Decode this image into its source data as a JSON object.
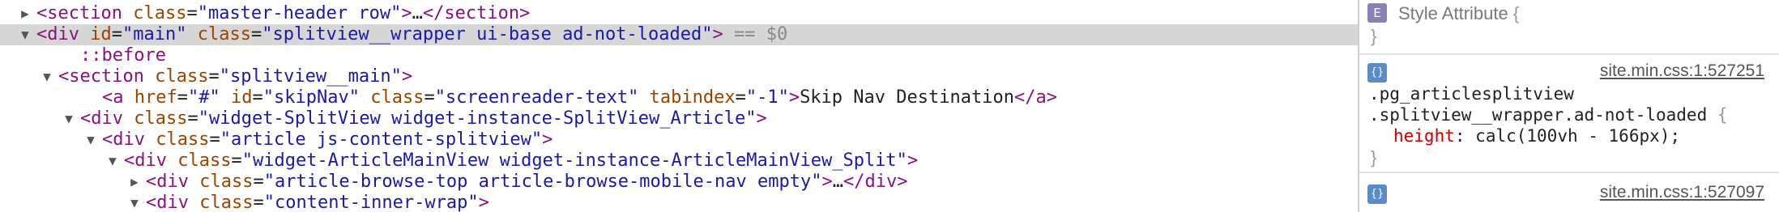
{
  "dom": {
    "lines": [
      {
        "indent": 1,
        "arrow": "▶",
        "parts": [
          {
            "cls": "tag",
            "t": "<section"
          },
          {
            "cls": "txt",
            "t": " "
          },
          {
            "cls": "attr",
            "t": "class"
          },
          {
            "cls": "txt",
            "t": "="
          },
          {
            "cls": "val",
            "t": "\"master-header row\""
          },
          {
            "cls": "tag",
            "t": ">"
          },
          {
            "cls": "ellip",
            "t": "…"
          },
          {
            "cls": "tag",
            "t": "</section>"
          }
        ]
      },
      {
        "indent": 1,
        "arrow": "▼",
        "selected": true,
        "parts": [
          {
            "cls": "tag",
            "t": "<div"
          },
          {
            "cls": "txt",
            "t": " "
          },
          {
            "cls": "attr",
            "t": "id"
          },
          {
            "cls": "txt",
            "t": "="
          },
          {
            "cls": "val",
            "t": "\"main\""
          },
          {
            "cls": "txt",
            "t": " "
          },
          {
            "cls": "attr",
            "t": "class"
          },
          {
            "cls": "txt",
            "t": "="
          },
          {
            "cls": "val",
            "t": "\"splitview__wrapper ui-base ad-not-loaded\""
          },
          {
            "cls": "tag",
            "t": ">"
          },
          {
            "cls": "dim",
            "t": " == $0"
          }
        ]
      },
      {
        "indent": 3,
        "arrow": "",
        "parts": [
          {
            "cls": "pseudo",
            "t": "::before"
          }
        ]
      },
      {
        "indent": 2,
        "arrow": "▼",
        "parts": [
          {
            "cls": "tag",
            "t": "<section"
          },
          {
            "cls": "txt",
            "t": " "
          },
          {
            "cls": "attr",
            "t": "class"
          },
          {
            "cls": "txt",
            "t": "="
          },
          {
            "cls": "val",
            "t": "\"splitview__main\""
          },
          {
            "cls": "tag",
            "t": ">"
          }
        ]
      },
      {
        "indent": 4,
        "arrow": "",
        "parts": [
          {
            "cls": "tag",
            "t": "<a"
          },
          {
            "cls": "txt",
            "t": " "
          },
          {
            "cls": "attr",
            "t": "href"
          },
          {
            "cls": "txt",
            "t": "="
          },
          {
            "cls": "link",
            "t": "\"#\""
          },
          {
            "cls": "txt",
            "t": " "
          },
          {
            "cls": "attr",
            "t": "id"
          },
          {
            "cls": "txt",
            "t": "="
          },
          {
            "cls": "val",
            "t": "\"skipNav\""
          },
          {
            "cls": "txt",
            "t": " "
          },
          {
            "cls": "attr",
            "t": "class"
          },
          {
            "cls": "txt",
            "t": "="
          },
          {
            "cls": "val",
            "t": "\"screenreader-text\""
          },
          {
            "cls": "txt",
            "t": " "
          },
          {
            "cls": "attr",
            "t": "tabindex"
          },
          {
            "cls": "txt",
            "t": "="
          },
          {
            "cls": "val",
            "t": "\"-1\""
          },
          {
            "cls": "tag",
            "t": ">"
          },
          {
            "cls": "txt",
            "t": "Skip Nav Destination"
          },
          {
            "cls": "tag",
            "t": "</a>"
          }
        ]
      },
      {
        "indent": 3,
        "arrow": "▼",
        "parts": [
          {
            "cls": "tag",
            "t": "<div"
          },
          {
            "cls": "txt",
            "t": " "
          },
          {
            "cls": "attr",
            "t": "class"
          },
          {
            "cls": "txt",
            "t": "="
          },
          {
            "cls": "val",
            "t": "\"widget-SplitView widget-instance-SplitView_Article\""
          },
          {
            "cls": "tag",
            "t": ">"
          }
        ]
      },
      {
        "indent": 4,
        "arrow": "▼",
        "parts": [
          {
            "cls": "tag",
            "t": "<div"
          },
          {
            "cls": "txt",
            "t": " "
          },
          {
            "cls": "attr",
            "t": "class"
          },
          {
            "cls": "txt",
            "t": "="
          },
          {
            "cls": "val",
            "t": "\"article js-content-splitview\""
          },
          {
            "cls": "tag",
            "t": ">"
          }
        ]
      },
      {
        "indent": 5,
        "arrow": "▼",
        "parts": [
          {
            "cls": "tag",
            "t": "<div"
          },
          {
            "cls": "txt",
            "t": " "
          },
          {
            "cls": "attr",
            "t": "class"
          },
          {
            "cls": "txt",
            "t": "="
          },
          {
            "cls": "val",
            "t": "\"widget-ArticleMainView widget-instance-ArticleMainView_Split\""
          },
          {
            "cls": "tag",
            "t": ">"
          }
        ]
      },
      {
        "indent": 6,
        "arrow": "▶",
        "parts": [
          {
            "cls": "tag",
            "t": "<div"
          },
          {
            "cls": "txt",
            "t": " "
          },
          {
            "cls": "attr",
            "t": "class"
          },
          {
            "cls": "txt",
            "t": "="
          },
          {
            "cls": "val",
            "t": "\"article-browse-top article-browse-mobile-nav empty\""
          },
          {
            "cls": "tag",
            "t": ">"
          },
          {
            "cls": "ellip",
            "t": "…"
          },
          {
            "cls": "tag",
            "t": "</div>"
          }
        ]
      },
      {
        "indent": 6,
        "arrow": "▼",
        "parts": [
          {
            "cls": "tag",
            "t": "<div"
          },
          {
            "cls": "txt",
            "t": " "
          },
          {
            "cls": "attr",
            "t": "class"
          },
          {
            "cls": "txt",
            "t": "="
          },
          {
            "cls": "val",
            "t": "\"content-inner-wrap\""
          },
          {
            "cls": "tag",
            "t": ">"
          }
        ]
      }
    ]
  },
  "styles": {
    "style_attribute": {
      "badge": "E",
      "title": "Style Attribute",
      "open_brace": "{",
      "close_brace": "}"
    },
    "rule1": {
      "badge": "{}",
      "source": "site.min.css:1:527251",
      "selector_line1": ".pg_articlesplitview",
      "selector_line2": ".splitview__wrapper.ad-not-loaded",
      "open_brace": "{",
      "property": "height",
      "colon": ":",
      "value": "calc(100vh - 166px);",
      "close_brace": "}"
    },
    "rule2": {
      "badge": "{}",
      "source": "site.min.css:1:527097"
    }
  }
}
